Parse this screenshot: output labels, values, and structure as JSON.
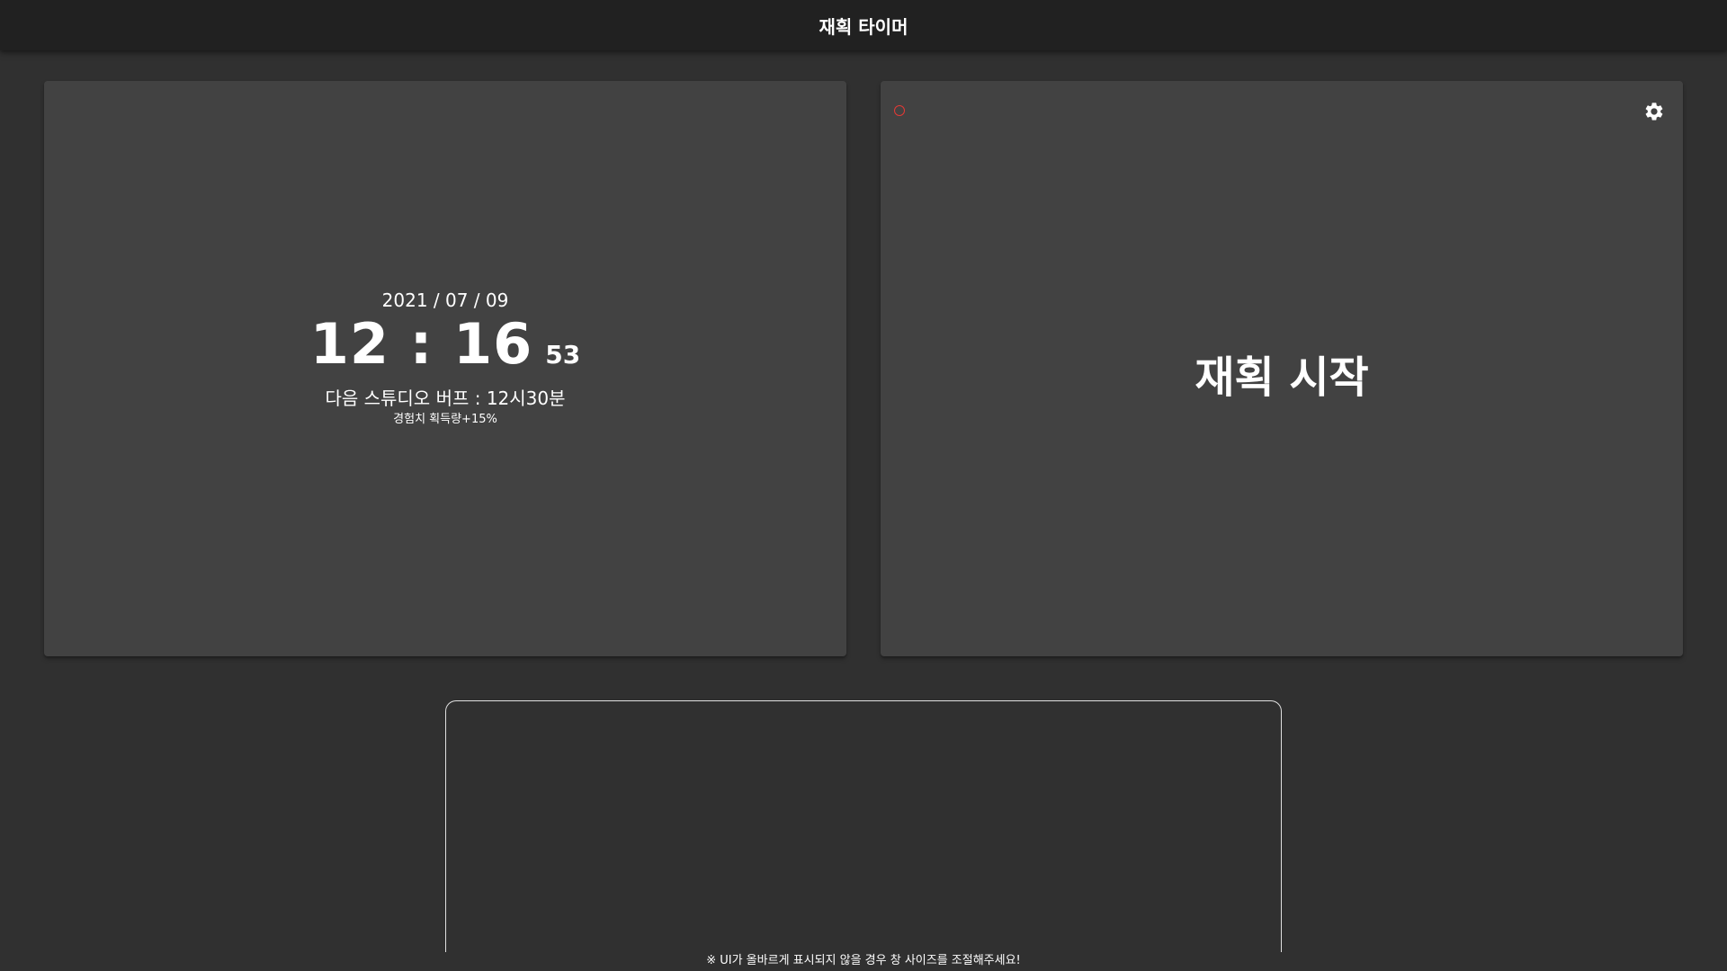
{
  "app": {
    "title": "재획 타이머"
  },
  "clock": {
    "date": "2021 / 07 / 09",
    "hour_minute": "12 : 16",
    "seconds": "53",
    "next_buff": "다음 스튜디오 버프 : 12시30분",
    "buff_effect": "경험치 획득량+15%"
  },
  "timer": {
    "status_icon": "circle-outline-icon",
    "status_color": "#e53935",
    "settings_icon": "gear-icon",
    "start_label": "재획 시작"
  },
  "footer": {
    "note": "※ UI가 올바르게 표시되지 않을 경우 창 사이즈를 조절해주세요!"
  },
  "colors": {
    "background": "#303030",
    "app_bar": "#212121",
    "card": "#424242",
    "text": "#ffffff"
  }
}
